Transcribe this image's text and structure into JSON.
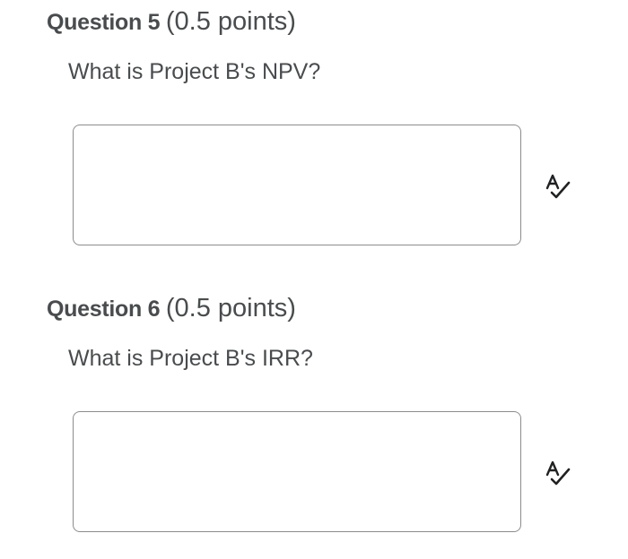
{
  "questions": [
    {
      "title": "Question 5",
      "points": "(0.5 points)",
      "prompt": "What is Project B's NPV?",
      "answer_value": "",
      "spell_check_icon": "spell-check-icon"
    },
    {
      "title": "Question 6",
      "points": "(0.5 points)",
      "prompt": "What is Project B's IRR?",
      "answer_value": "",
      "spell_check_icon": "spell-check-icon"
    }
  ],
  "colors": {
    "text": "#494c4e",
    "border": "#8a8c8e",
    "icon": "#202122"
  }
}
